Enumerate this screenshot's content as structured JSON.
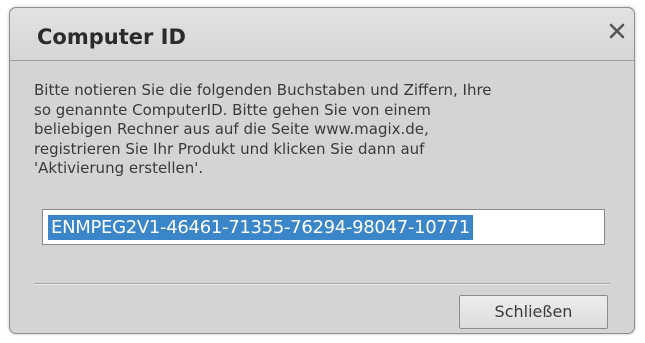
{
  "dialog": {
    "title": "Computer ID",
    "close_icon": "close-icon",
    "message_lines": [
      "Bitte notieren Sie die folgenden Buchstaben und Ziffern, Ihre",
      "so genannte ComputerID. Bitte gehen Sie von einem",
      "beliebigen Rechner aus auf die Seite www.magix.de,",
      "registrieren Sie Ihr Produkt und klicken Sie dann auf",
      "'Aktivierung erstellen'."
    ],
    "computer_id": "ENMPEG2V1-46461-71355-76294-98047-10771",
    "close_button_label": "Schließen"
  },
  "colors": {
    "dialog_bg": "#d4d4d4",
    "selection": "#3a86c8",
    "text": "#3a3a3a"
  }
}
